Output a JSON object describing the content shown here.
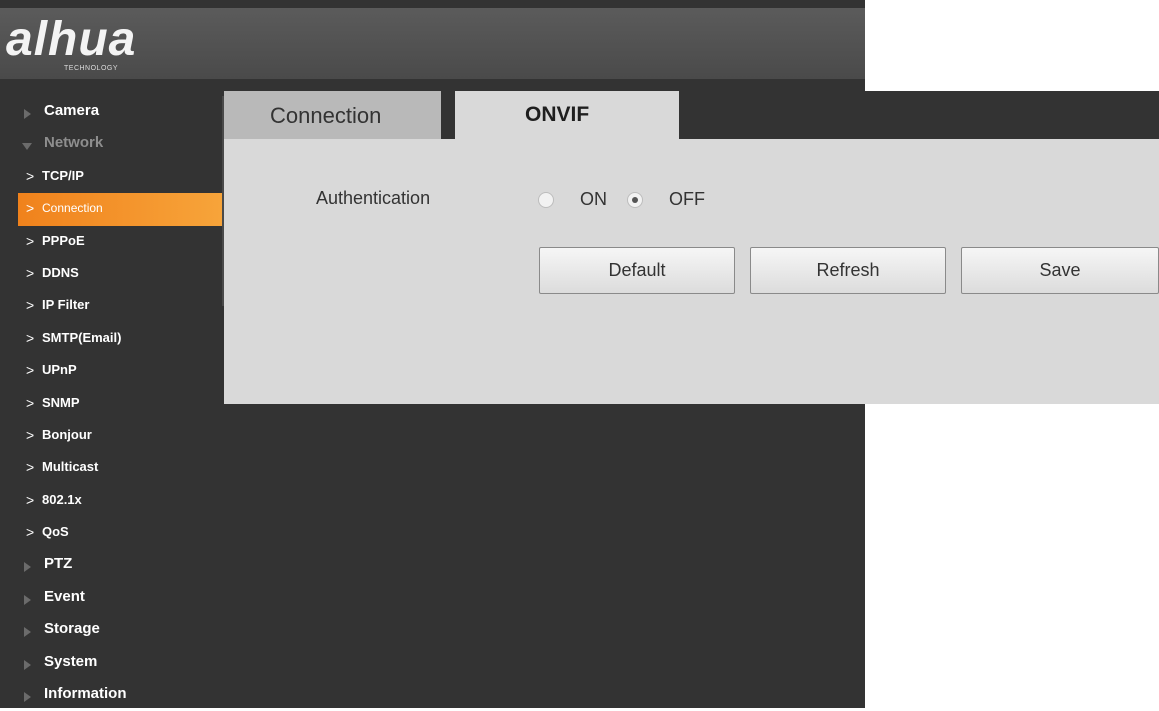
{
  "brand": {
    "logo": "alhua",
    "tagline": "TECHNOLOGY"
  },
  "sidebar": {
    "items": [
      {
        "label": "Camera"
      },
      {
        "label": "Network"
      },
      {
        "label": "PTZ"
      },
      {
        "label": "Event"
      },
      {
        "label": "Storage"
      },
      {
        "label": "System"
      },
      {
        "label": "Information"
      }
    ],
    "network_sub": [
      {
        "label": "TCP/IP"
      },
      {
        "label": "Connection"
      },
      {
        "label": "PPPoE"
      },
      {
        "label": "DDNS"
      },
      {
        "label": "IP Filter"
      },
      {
        "label": "SMTP(Email)"
      },
      {
        "label": "UPnP"
      },
      {
        "label": "SNMP"
      },
      {
        "label": "Bonjour"
      },
      {
        "label": "Multicast"
      },
      {
        "label": "802.1x"
      },
      {
        "label": "QoS"
      }
    ],
    "chevron": ">"
  },
  "tabs": [
    {
      "label": "Connection",
      "active": false
    },
    {
      "label": "ONVIF",
      "active": true
    }
  ],
  "form": {
    "auth_label": "Authentication",
    "options": [
      {
        "label": "ON",
        "checked": false
      },
      {
        "label": "OFF",
        "checked": true
      }
    ],
    "buttons": {
      "default": "Default",
      "refresh": "Refresh",
      "save": "Save"
    }
  },
  "colors": {
    "active_item": "#f0821c",
    "sidebar_bg": "#333333",
    "panel_bg": "#d9d9d9"
  }
}
